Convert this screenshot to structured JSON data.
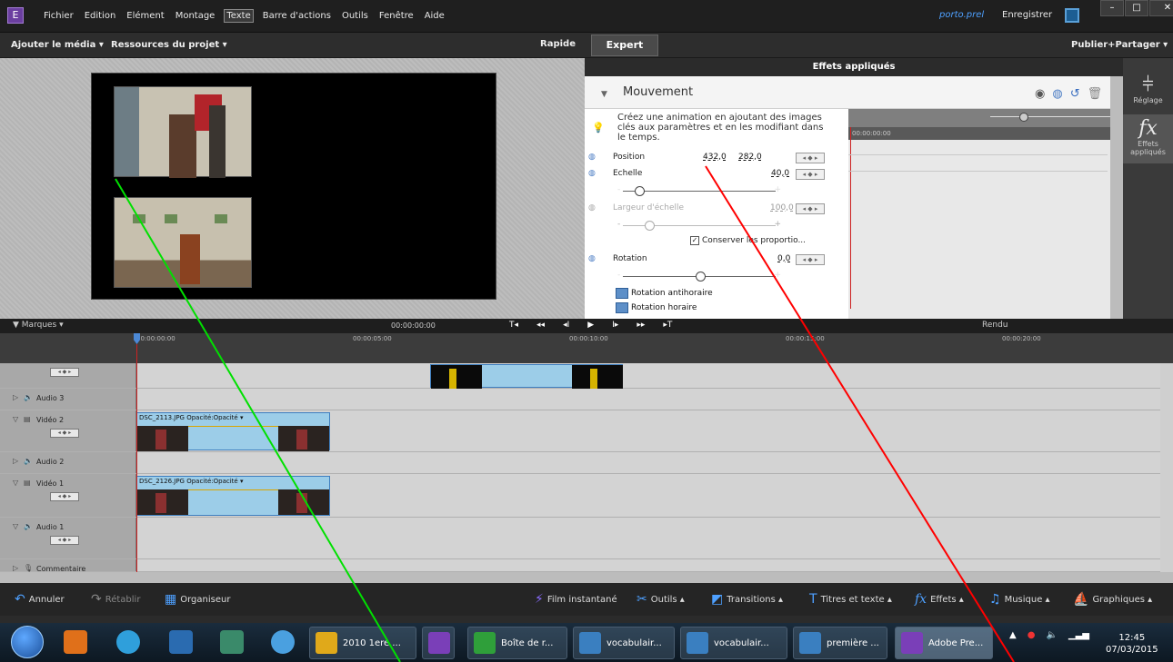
{
  "app": {
    "menus": [
      "Fichier",
      "Edition",
      "Elément",
      "Montage",
      "Texte",
      "Barre d'actions",
      "Outils",
      "Fenêtre",
      "Aide"
    ],
    "active_menu_index": 4,
    "project_name": "porto.prel",
    "save_label": "Enregistrer",
    "window_buttons": [
      "–",
      "□",
      "✕"
    ]
  },
  "toolbar": {
    "add_media": "Ajouter le média ▾",
    "resources": "Ressources du projet ▾",
    "rapide": "Rapide",
    "expert": "Expert",
    "publish": "Publier+Partager ▾"
  },
  "effects": {
    "title": "Effets appliqués",
    "section": "Mouvement",
    "hint": "Créez une animation en ajoutant des images clés aux paramètres et en les modifiant dans le temps.",
    "position_label": "Position",
    "position_x": "432,0",
    "position_y": "282,0",
    "scale_label": "Echelle",
    "scale_value": "40,0",
    "scale_fraction": 0.08,
    "width_label": "Largeur d'échelle",
    "width_value": "100,0",
    "width_fraction": 0.15,
    "keep_label": "Conserver les proportio...",
    "rotation_label": "Rotation",
    "rotation_value": "0,0",
    "rotation_fraction": 0.5,
    "rot_ccw": "Rotation antihoraire",
    "rot_cw": "Rotation horaire",
    "fx_timecode": "00:00:00:00",
    "kf_nav": "◂ ◆ ▸"
  },
  "side": {
    "reglage": "Réglage",
    "effets": "Effets appliqués"
  },
  "transport": {
    "marques": "▼ Marques ▾",
    "timecode": "00:00:00:00",
    "buttons": [
      "T◂",
      "◂◂",
      "◂I",
      "▶",
      "I▸",
      "▸▸",
      "▸T"
    ],
    "rendu": "Rendu"
  },
  "ruler": {
    "ticks": [
      "00:00:00:00",
      "00:00:05:00",
      "00:00:10:00",
      "00:00:15:00",
      "00:00:20:00"
    ]
  },
  "tracks": [
    {
      "name": "",
      "type": "title",
      "kf": "◂ ◆ ▸"
    },
    {
      "name": "Audio 3",
      "type": "audio"
    },
    {
      "name": "Vidéo 2",
      "type": "video",
      "clip": "DSC_2113.JPG  Opacité:Opacité ▾",
      "kf": "◂ ◆ ▸"
    },
    {
      "name": "Audio 2",
      "type": "audio"
    },
    {
      "name": "Vidéo 1",
      "type": "video",
      "clip": "DSC_2126.JPG  Opacité:Opacité ▾",
      "kf": "◂ ◆ ▸"
    },
    {
      "name": "Audio 1",
      "type": "audio",
      "kf": "◂ ◆ ▸"
    },
    {
      "name": "Commentaire",
      "type": "mic"
    }
  ],
  "bottom": {
    "undo": "Annuler",
    "redo": "Rétablir",
    "organizer": "Organiseur",
    "instant_movie": "Film instantané",
    "tools": "Outils ▴",
    "transitions": "Transitions ▴",
    "titles": "Titres et texte ▴",
    "effects": "Effets ▴",
    "music": "Musique ▴",
    "graphics": "Graphiques ▴"
  },
  "taskbar": {
    "tasks": [
      "2010 1ere ...",
      "",
      "Boîte de r...",
      "vocabulair...",
      "vocabulair...",
      "première ...",
      "Adobe Pre..."
    ],
    "time": "12:45",
    "date": "07/03/2015"
  },
  "colors": {
    "accent": "#4ea0ff",
    "annotation_green": "#00e000",
    "annotation_red": "#ff0000"
  }
}
